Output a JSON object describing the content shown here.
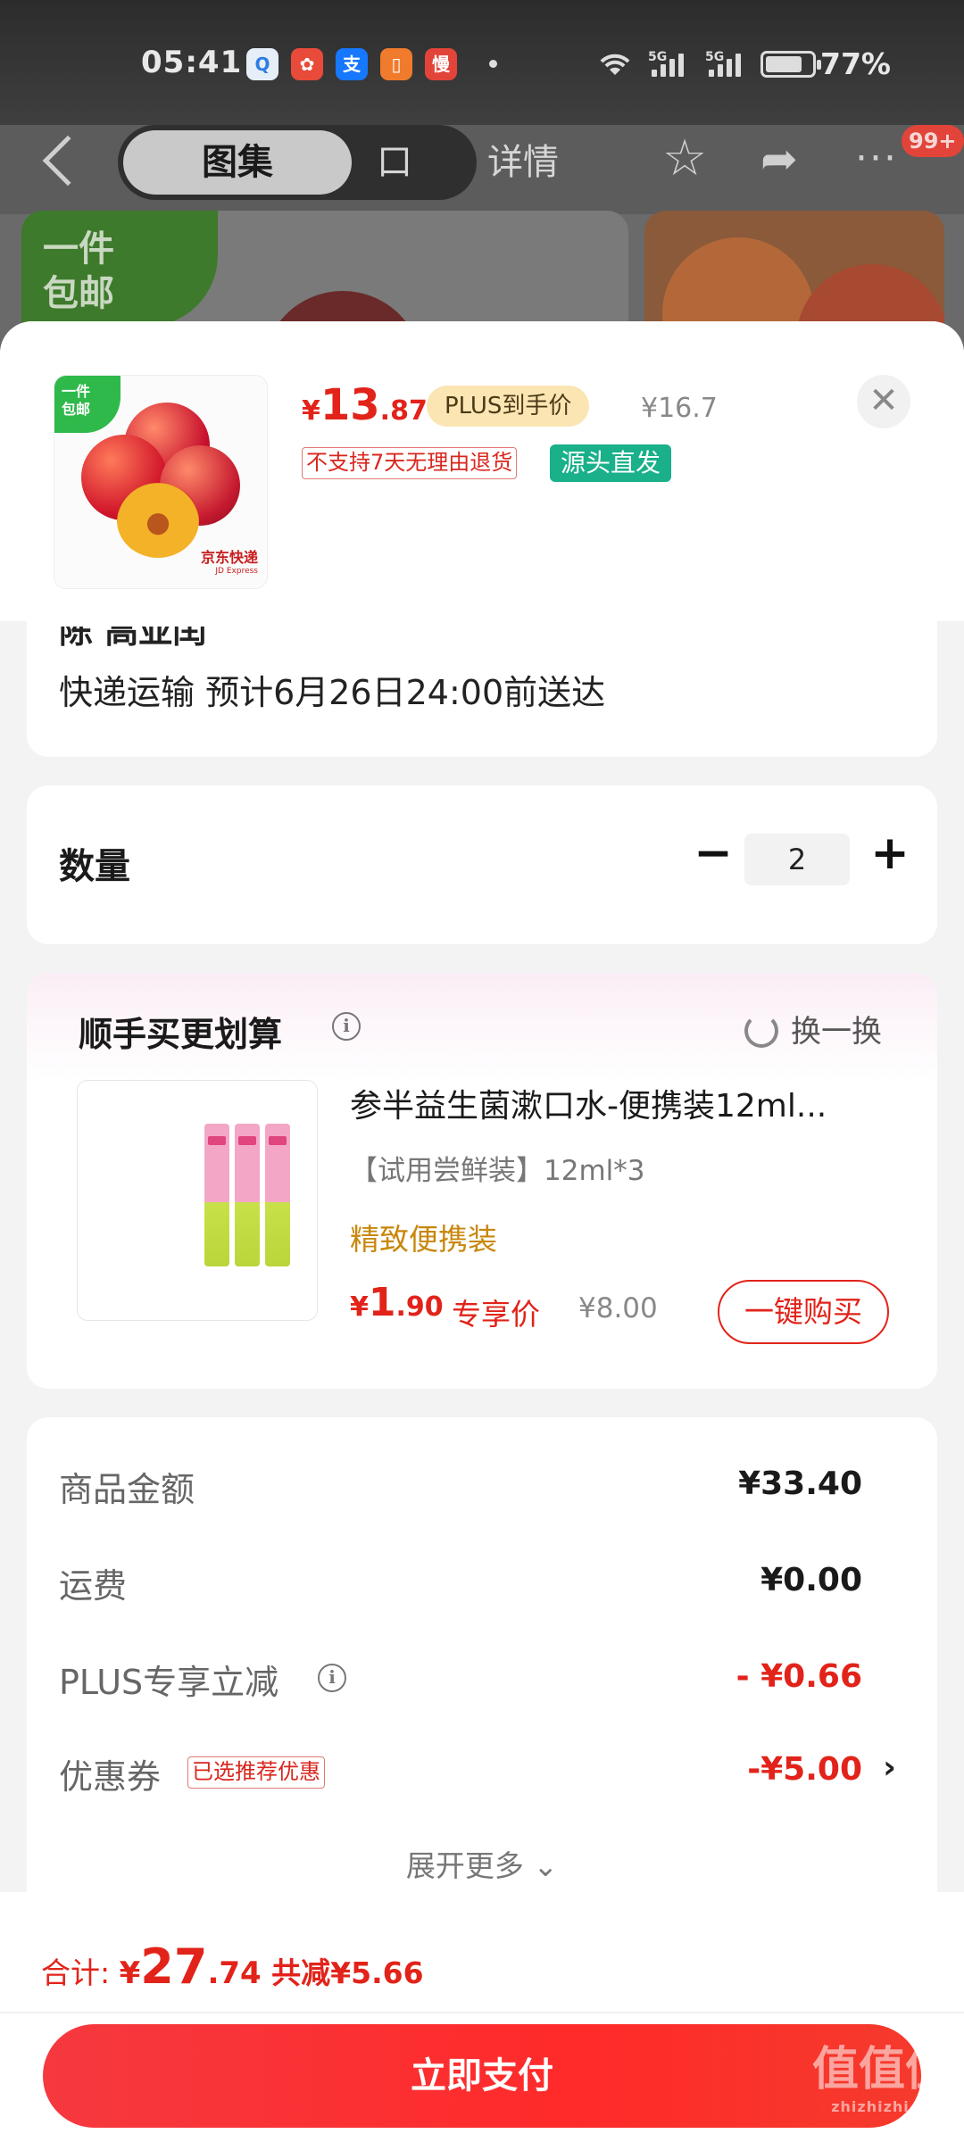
{
  "status_bar": {
    "time": "05:41",
    "battery": "77%",
    "network_1": "5G",
    "network_2": "5G",
    "app_icons": [
      "qq-browser-icon",
      "game-icon",
      "alipay-icon",
      "reader-icon",
      "slow-app-icon"
    ]
  },
  "nav": {
    "tabs": [
      "图集",
      "口碑",
      "详情"
    ],
    "active_tab": "图集",
    "badge": "99+"
  },
  "background": {
    "ribbon_text": "一件\n包邮"
  },
  "product": {
    "image_tag": "一件\n包邮",
    "image_brand": "京东快递",
    "image_brand_sub": "JD Express",
    "price_currency": "¥",
    "price_int": "13",
    "price_dec": ".87",
    "plus_label": "PLUS到手价",
    "original_price": "¥16.7",
    "return_tag": "不支持7天无理由退货",
    "origin_tag": "源头直发",
    "close_icon": "✕"
  },
  "delivery": {
    "address_partial": "陈 高亚闰",
    "text": "快递运输 预计6月26日24:00前送达"
  },
  "quantity": {
    "label": "数量",
    "value": "2",
    "minus": "−",
    "plus": "+"
  },
  "upsell": {
    "title": "顺手买更划算",
    "refresh": "换一换",
    "name": "参半益生菌漱口水-便携装12ml...",
    "spec": "【试用尝鲜装】12ml*3",
    "selling_point": "精致便携装",
    "price_currency": "¥",
    "price_int": "1",
    "price_dec": ".90",
    "exclusive": "专享价",
    "original_price": "¥8.00",
    "buy_button": "一键购买"
  },
  "summary": {
    "rows": [
      {
        "label": "商品金额",
        "value": "¥33.40"
      },
      {
        "label": "运费",
        "value": "¥0.00"
      },
      {
        "label": "PLUS专享立减",
        "value": "- ¥0.66"
      },
      {
        "label": "优惠券",
        "badge": "已选推荐优惠",
        "value": "-¥5.00"
      }
    ],
    "expand": "展开更多"
  },
  "footer": {
    "total_label": "合计: ",
    "total_currency": "¥",
    "total_int": "27",
    "total_dec": ".74",
    "saved": " 共减¥5.66",
    "pay_button": "立即支付"
  },
  "watermark": {
    "text": "值值值",
    "sub": "zhizhizhi.com"
  },
  "colors": {
    "accent_red": "#e2231a",
    "plus_gold": "#fbe6b3",
    "green_tag": "#19b08a"
  }
}
